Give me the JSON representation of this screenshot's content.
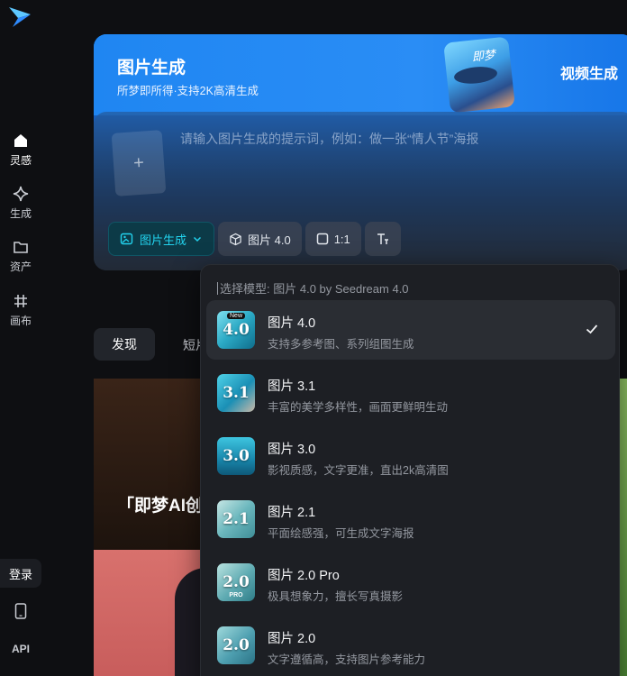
{
  "sidebar": {
    "items": [
      {
        "label": "灵感",
        "icon": "home-icon"
      },
      {
        "label": "生成",
        "icon": "sparkle-icon"
      },
      {
        "label": "资产",
        "icon": "folder-icon"
      },
      {
        "label": "画布",
        "icon": "canvas-grid-icon"
      }
    ],
    "login_label": "登录",
    "bottom_icons": [
      "phone-icon"
    ],
    "api_label": "API"
  },
  "generator": {
    "title": "图片生成",
    "subtitle": "所梦即所得·支持2K高清生成",
    "promo_logo_text": "即梦",
    "video_tab_label": "视频生成",
    "prompt_placeholder": "请输入图片生成的提示词，例如：做一张“情人节”海报",
    "toolbar": {
      "mode_label": "图片生成",
      "model_label": "图片 4.0",
      "ratio_label": "1:1"
    }
  },
  "feed": {
    "tabs": [
      "发现",
      "短片"
    ],
    "card_title": "「即梦AI创"
  },
  "model_dropdown": {
    "header_prefix": "选择模型: ",
    "header_value": "图片 4.0 by Seedream 4.0",
    "items": [
      {
        "name": "图片 4.0",
        "desc": "支持多参考图、系列组图生成",
        "thumb": "4.0",
        "badge": "New",
        "selected": true
      },
      {
        "name": "图片 3.1",
        "desc": "丰富的美学多样性，画面更鲜明生动",
        "thumb": "3.1",
        "selected": false
      },
      {
        "name": "图片 3.0",
        "desc": "影视质感，文字更准，直出2k高清图",
        "thumb": "3.0",
        "selected": false
      },
      {
        "name": "图片 2.1",
        "desc": "平面绘感强，可生成文字海报",
        "thumb": "2.1",
        "selected": false
      },
      {
        "name": "图片 2.0 Pro",
        "desc": "极具想象力，擅长写真摄影",
        "thumb": "2.0",
        "thumb_sub": "PRO",
        "selected": false
      },
      {
        "name": "图片 2.0",
        "desc": "文字遵循高，支持图片参考能力",
        "thumb": "2.0",
        "selected": false
      }
    ]
  },
  "colors": {
    "accent_cyan": "#22d3ee",
    "brand_blue": "#1f86f2",
    "dropdown_bg": "#1d1f24"
  }
}
